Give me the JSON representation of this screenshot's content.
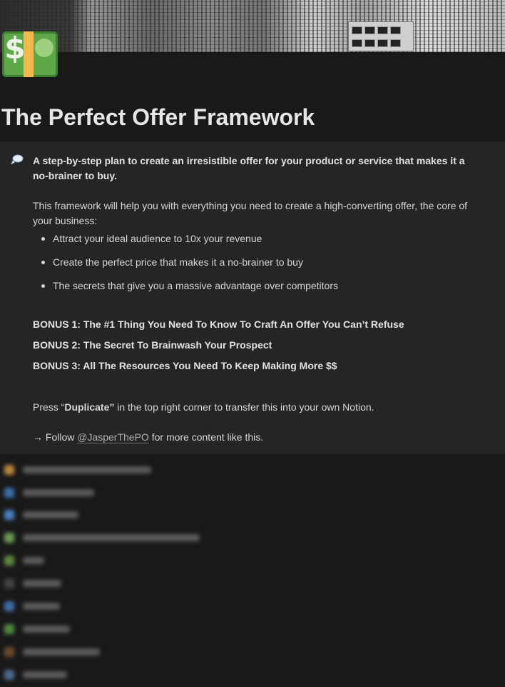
{
  "page": {
    "title": "The Perfect Offer Framework",
    "icon": "money-bill-icon"
  },
  "callout": {
    "icon": "thought-balloon-icon",
    "lead": "A step-by-step plan to create an irresistible offer for your product or service that makes it a no-brainer to buy.",
    "intro": "This framework will help you with everything you need to create a high-converting offer, the core of your business:",
    "bullets": [
      "Attract your ideal audience to 10x your revenue",
      "Create the perfect price that makes it a no-brainer to buy",
      "The secrets that give you a massive advantage over competitors"
    ],
    "bonuses": [
      "BONUS 1: The #1 Thing You Need To Know To Craft An Offer You Can’t Refuse",
      "BONUS 2: The Secret To Brainwash Your Prospect",
      "BONUS 3: All The Resources You Need To Keep Making More $$"
    ],
    "duplicate_prefix": "Press “",
    "duplicate_bold": "Duplicate”",
    "duplicate_suffix": " in the top right corner to transfer this into your own Notion.",
    "follow_prefix": "→ Follow ",
    "follow_handle": "@JasperThePO",
    "follow_suffix": " for more content like this."
  },
  "colors": {
    "background": "#191919",
    "callout_bg": "#252525",
    "text": "#d6d6d6",
    "icon_green": "#5ea84a",
    "icon_band": "#f2b84b"
  }
}
